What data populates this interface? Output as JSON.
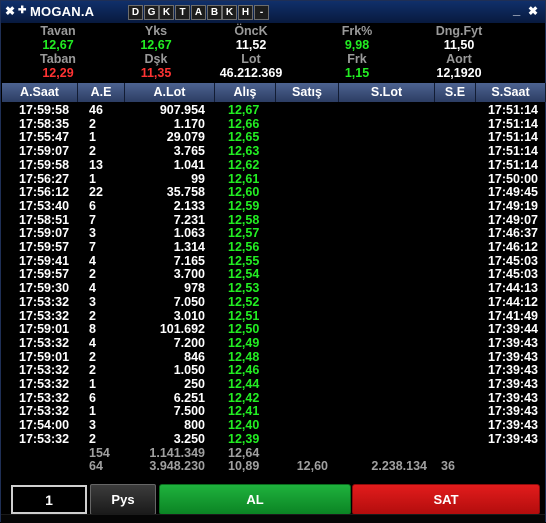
{
  "titlebar": {
    "close_glyph": "✖",
    "pin_glyph": "✚",
    "symbol": "MOGAN.A",
    "buttons": [
      "D",
      "G",
      "K",
      "T",
      "A",
      "B",
      "K",
      "H",
      "-"
    ],
    "minimize_glyph": "_",
    "maximize_glyph": "✖"
  },
  "stats": {
    "cols": [
      {
        "top_label": "Tavan",
        "top_value": "12,67",
        "top_color": "#22ee22",
        "bot_label": "Taban",
        "bot_value": "12,29",
        "bot_color": "#ff3333"
      },
      {
        "top_label": "Yks",
        "top_value": "12,67",
        "top_color": "#22ee22",
        "bot_label": "Dşk",
        "bot_value": "11,35",
        "bot_color": "#ff3333"
      },
      {
        "top_label": "ÖncK",
        "top_value": "11,52",
        "top_color": "#ffffff",
        "bot_label": "Lot",
        "bot_value": "46.212.369",
        "bot_color": "#ffffff"
      },
      {
        "top_label": "Frk%",
        "top_value": "9,98",
        "top_color": "#22ee22",
        "bot_label": "Frk",
        "bot_value": "1,15",
        "bot_color": "#22ee22"
      },
      {
        "top_label": "Dng.Fyt",
        "top_value": "11,50",
        "top_color": "#ffffff",
        "bot_label": "Aort",
        "bot_value": "12,1920",
        "bot_color": "#ffffff"
      }
    ]
  },
  "table": {
    "headers": [
      "A.Saat",
      "A.E",
      "A.Lot",
      "Alış",
      "Satış",
      "S.Lot",
      "S.E",
      "S.Saat"
    ],
    "rows": [
      [
        "17:59:58",
        "46",
        "907.954",
        "12,67",
        "",
        "",
        "",
        "17:51:14"
      ],
      [
        "17:58:35",
        "2",
        "1.170",
        "12,66",
        "",
        "",
        "",
        "17:51:14"
      ],
      [
        "17:55:47",
        "1",
        "29.079",
        "12,65",
        "",
        "",
        "",
        "17:51:14"
      ],
      [
        "17:59:07",
        "2",
        "3.765",
        "12,63",
        "",
        "",
        "",
        "17:51:14"
      ],
      [
        "17:59:58",
        "13",
        "1.041",
        "12,62",
        "",
        "",
        "",
        "17:51:14"
      ],
      [
        "17:56:27",
        "1",
        "99",
        "12,61",
        "",
        "",
        "",
        "17:50:00"
      ],
      [
        "17:56:12",
        "22",
        "35.758",
        "12,60",
        "",
        "",
        "",
        "17:49:45"
      ],
      [
        "17:53:40",
        "6",
        "2.133",
        "12,59",
        "",
        "",
        "",
        "17:49:19"
      ],
      [
        "17:58:51",
        "7",
        "7.231",
        "12,58",
        "",
        "",
        "",
        "17:49:07"
      ],
      [
        "17:59:07",
        "3",
        "1.063",
        "12,57",
        "",
        "",
        "",
        "17:46:37"
      ],
      [
        "17:59:57",
        "7",
        "1.314",
        "12,56",
        "",
        "",
        "",
        "17:46:12"
      ],
      [
        "17:59:41",
        "4",
        "7.165",
        "12,55",
        "",
        "",
        "",
        "17:45:03"
      ],
      [
        "17:59:57",
        "2",
        "3.700",
        "12,54",
        "",
        "",
        "",
        "17:45:03"
      ],
      [
        "17:59:30",
        "4",
        "978",
        "12,53",
        "",
        "",
        "",
        "17:44:13"
      ],
      [
        "17:53:32",
        "3",
        "7.050",
        "12,52",
        "",
        "",
        "",
        "17:44:12"
      ],
      [
        "17:53:32",
        "2",
        "3.010",
        "12,51",
        "",
        "",
        "",
        "17:41:49"
      ],
      [
        "17:59:01",
        "8",
        "101.692",
        "12,50",
        "",
        "",
        "",
        "17:39:44"
      ],
      [
        "17:53:32",
        "4",
        "7.200",
        "12,49",
        "",
        "",
        "",
        "17:39:43"
      ],
      [
        "17:59:01",
        "2",
        "846",
        "12,48",
        "",
        "",
        "",
        "17:39:43"
      ],
      [
        "17:53:32",
        "2",
        "1.050",
        "12,46",
        "",
        "",
        "",
        "17:39:43"
      ],
      [
        "17:53:32",
        "1",
        "250",
        "12,44",
        "",
        "",
        "",
        "17:39:43"
      ],
      [
        "17:53:32",
        "6",
        "6.251",
        "12,42",
        "",
        "",
        "",
        "17:39:43"
      ],
      [
        "17:53:32",
        "1",
        "7.500",
        "12,41",
        "",
        "",
        "",
        "17:39:43"
      ],
      [
        "17:54:00",
        "3",
        "800",
        "12,40",
        "",
        "",
        "",
        "17:39:43"
      ],
      [
        "17:53:32",
        "2",
        "3.250",
        "12,39",
        "",
        "",
        "",
        "17:39:43"
      ]
    ],
    "summary": [
      [
        "",
        "154",
        "1.141.349",
        "12,64",
        "",
        "",
        "",
        ""
      ],
      [
        "",
        "64",
        "3.948.230",
        "10,89",
        "12,60",
        "2.238.134",
        "36",
        ""
      ]
    ]
  },
  "bottom": {
    "quantity_value": "1",
    "pys_label": "Pys",
    "buy_label": "AL",
    "sell_label": "SAT"
  },
  "colors": {
    "buy_green": "#22ee22",
    "sell_red": "#ff3333",
    "header_blue": "#3b5080",
    "title_blue": "#0c2752"
  }
}
